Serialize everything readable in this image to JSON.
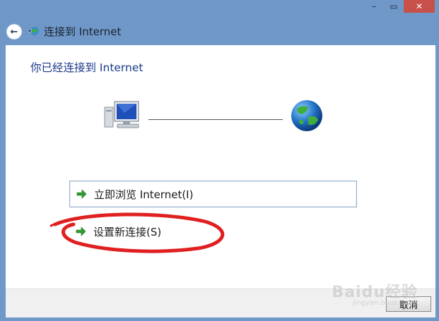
{
  "window": {
    "title": "连接到 Internet",
    "controls": {
      "minimize": "–",
      "maximize": "▭",
      "close": "✕"
    }
  },
  "header": {
    "back_icon": "back-arrow-icon",
    "title_icon": "network-connection-icon"
  },
  "main": {
    "heading": "你已经连接到 Internet",
    "diagram": {
      "left_icon": "computer-icon",
      "right_icon": "globe-icon"
    },
    "options": [
      {
        "label": "立即浏览 Internet(I)",
        "icon": "green-arrow-icon"
      },
      {
        "label": "设置新连接(S)",
        "icon": "green-arrow-icon"
      }
    ]
  },
  "footer": {
    "cancel_label": "取消"
  },
  "annotation": {
    "color": "#e02020"
  },
  "watermark": {
    "text": "Baidu经验",
    "sub": "jingyan.baidu.com"
  }
}
